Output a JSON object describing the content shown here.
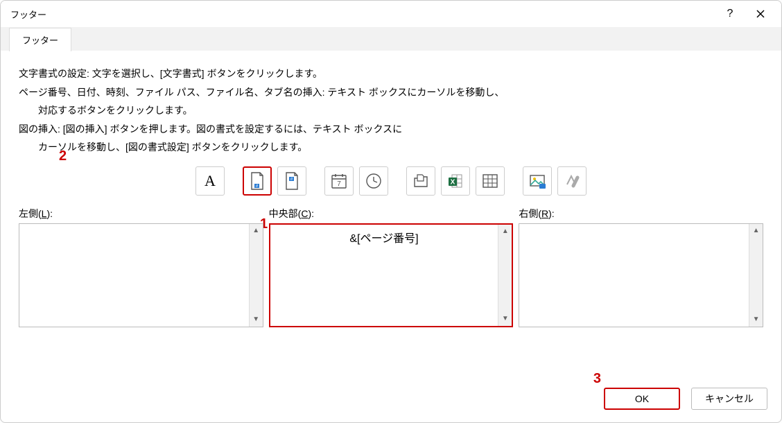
{
  "titlebar": {
    "title": "フッター"
  },
  "tab": {
    "label": "フッター"
  },
  "instructions": {
    "line1": "文字書式の設定: 文字を選択し、[文字書式] ボタンをクリックします。",
    "line2": "ページ番号、日付、時刻、ファイル パス、ファイル名、タブ名の挿入: テキスト ボックスにカーソルを移動し、",
    "line2b": "対応するボタンをクリックします。",
    "line3": "図の挿入: [図の挿入] ボタンを押します。図の書式を設定するには、テキスト ボックスに",
    "line3b": "カーソルを移動し、[図の書式設定] ボタンをクリックします。"
  },
  "toolbar": {
    "format_text": "A",
    "page_number": "#",
    "total_pages": "#",
    "date": "7",
    "time": "clock",
    "file_path": "folder-page",
    "file_name": "excel",
    "sheet_name": "grid",
    "insert_picture": "picture",
    "format_picture": "format-picture"
  },
  "fields": {
    "left": {
      "label_pre": "左側(",
      "label_u": "L",
      "label_post": "):",
      "value": ""
    },
    "center": {
      "label_pre": "中央部(",
      "label_u": "C",
      "label_post": "):",
      "value": "&[ページ番号]"
    },
    "right": {
      "label_pre": "右側(",
      "label_u": "R",
      "label_post": "):",
      "value": ""
    }
  },
  "buttons": {
    "ok": "OK",
    "cancel": "キャンセル"
  },
  "annotations": {
    "a1": "1",
    "a2": "2",
    "a3": "3"
  }
}
